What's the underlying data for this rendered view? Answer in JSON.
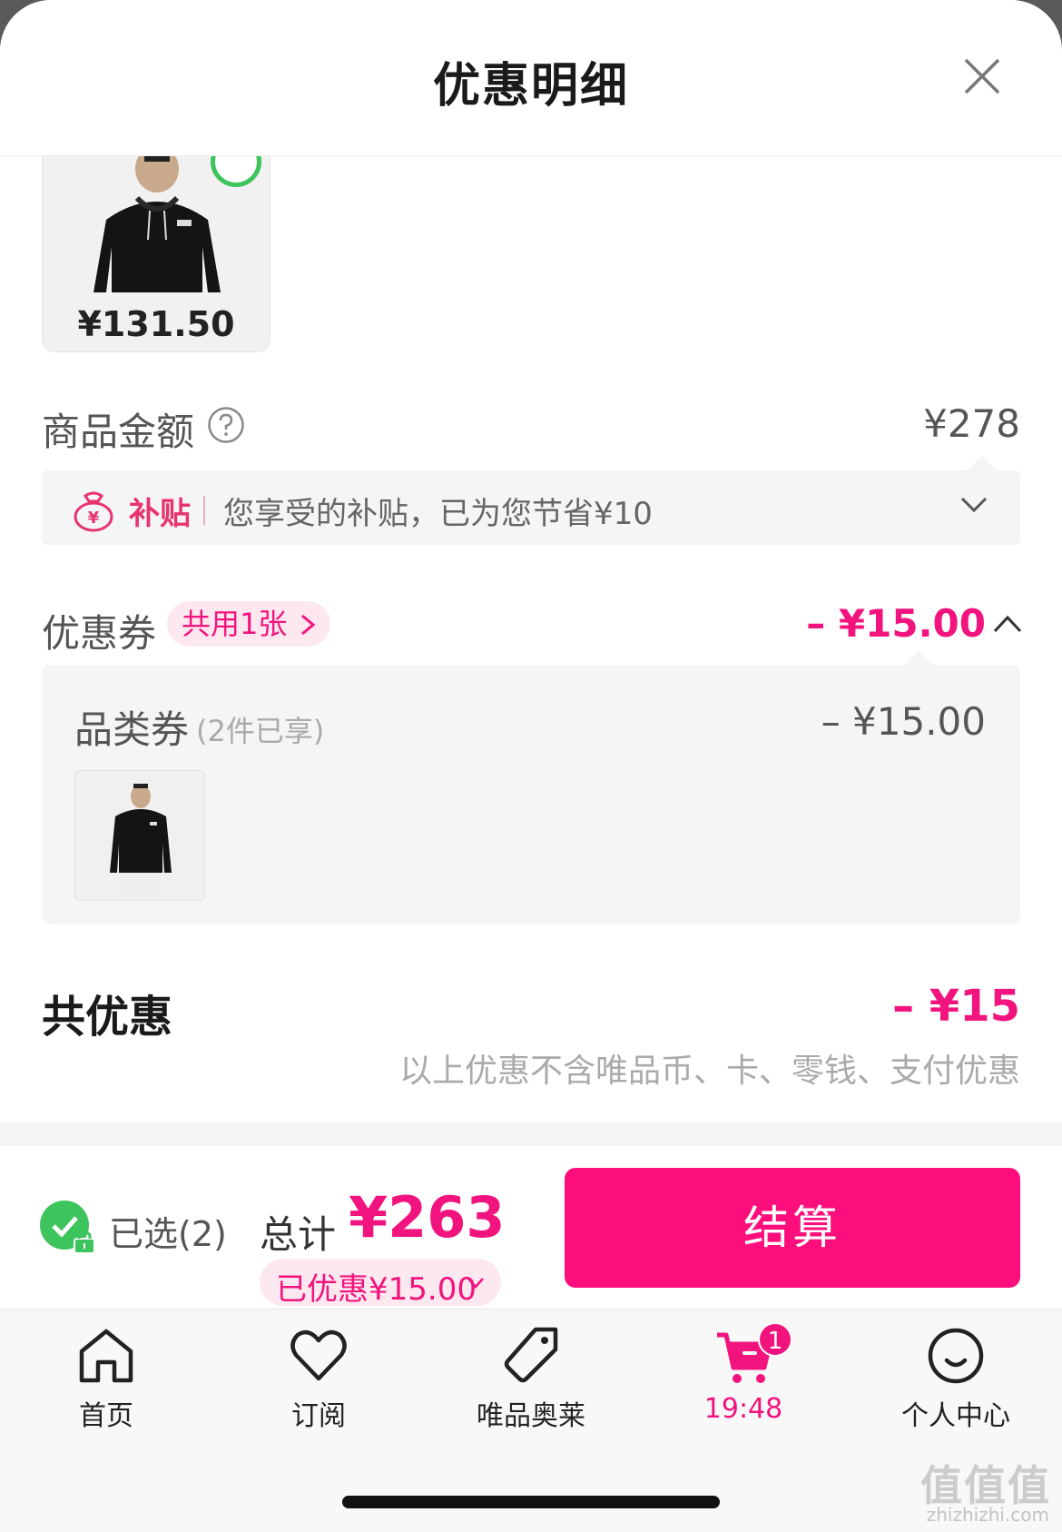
{
  "header": {
    "title": "优惠明细"
  },
  "product": {
    "price": "¥131.50"
  },
  "goods": {
    "label": "商品金额",
    "amount": "¥278"
  },
  "subsidy": {
    "tag": "补贴",
    "text": "您享受的补贴，已为您节省¥10"
  },
  "coupon": {
    "label": "优惠券",
    "pill": "共用1张",
    "amount": "– ¥15.00",
    "category": {
      "title": "品类券",
      "note": "(2件已享)",
      "amount": "– ¥15.00"
    }
  },
  "summary": {
    "label": "共优惠",
    "amount": "– ¥15",
    "disclaimer": "以上优惠不含唯品币、卡、零钱、支付优惠"
  },
  "checkout": {
    "selected": "已选(2)",
    "total_label": "总计",
    "total_amount": "¥263",
    "discount": "已优惠¥15.00",
    "pay_button": "结算"
  },
  "tabbar": {
    "items": [
      {
        "label": "首页",
        "icon": "home-icon"
      },
      {
        "label": "订阅",
        "icon": "heart-icon"
      },
      {
        "label": "唯品奥莱",
        "icon": "tag-icon"
      },
      {
        "label": "19:48",
        "icon": "cart-icon",
        "badge": "1"
      },
      {
        "label": "个人中心",
        "icon": "smile-icon"
      }
    ]
  },
  "watermark": {
    "text": "值值值",
    "sub": "zhizhizhi.com"
  },
  "colors": {
    "accent": "#f2147e",
    "pay": "#fd0e7d",
    "check": "#3ec45c"
  }
}
